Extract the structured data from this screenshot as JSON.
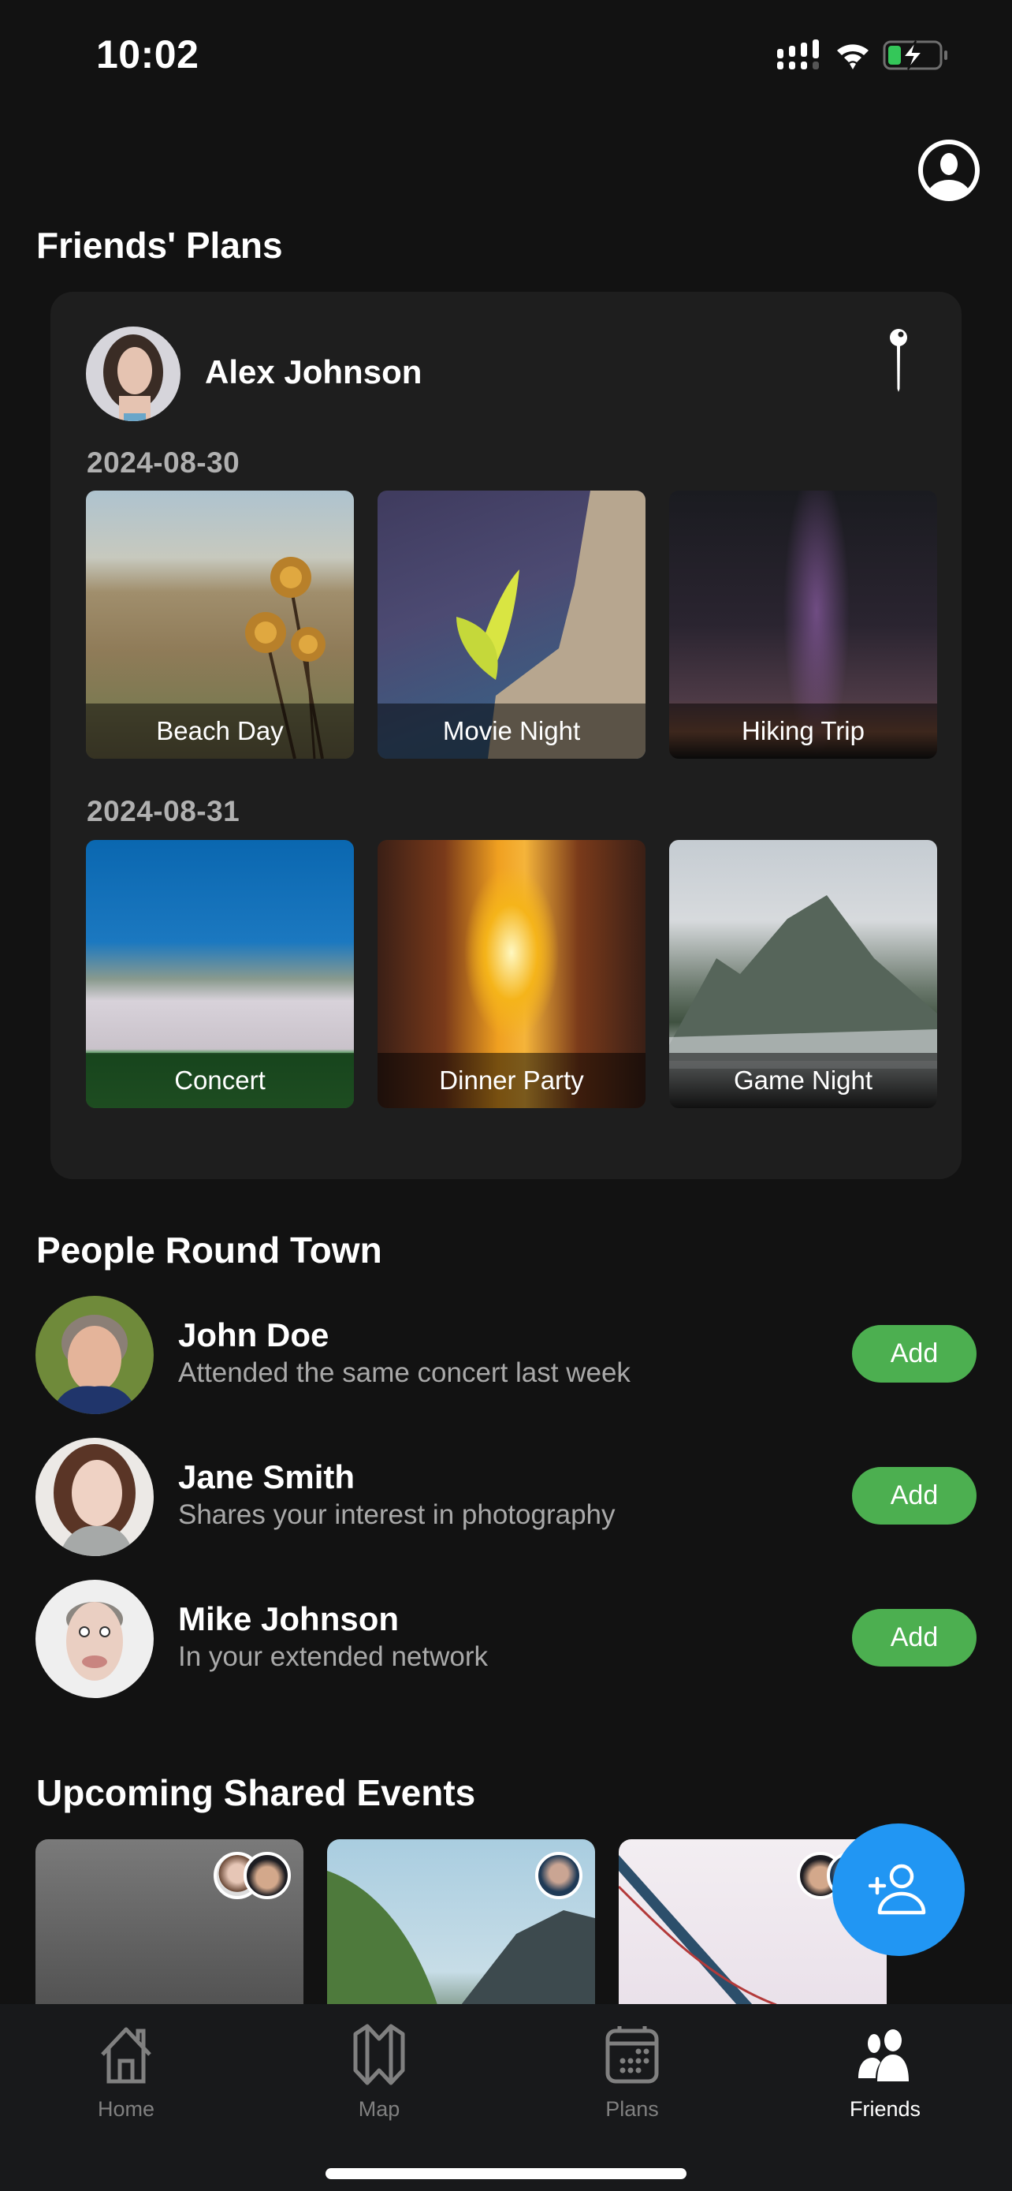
{
  "status_bar": {
    "time": "10:02",
    "battery_color": "#34c759"
  },
  "header": {
    "profile_icon": "user-circle-icon"
  },
  "friends_plans": {
    "title": "Friends' Plans",
    "friend": {
      "name": "Alex Johnson",
      "pin_icon": "pin-icon"
    },
    "days": [
      {
        "date": "2024-08-30",
        "plans": [
          {
            "label": "Beach Day",
            "image": "dry-flowers-valley"
          },
          {
            "label": "Movie Night",
            "image": "plant-on-rock"
          },
          {
            "label": "Hiking Trip",
            "image": "milky-way-night-sky"
          }
        ]
      },
      {
        "date": "2024-08-31",
        "plans": [
          {
            "label": "Concert",
            "image": "stadium-crowd-mountains"
          },
          {
            "label": "Dinner Party",
            "image": "sunset-city-street"
          },
          {
            "label": "Game Night",
            "image": "misty-mountain"
          }
        ]
      }
    ]
  },
  "people": {
    "title": "People Round Town",
    "add_label": "Add",
    "add_color": "#4caf50",
    "list": [
      {
        "name": "John Doe",
        "reason": "Attended the same concert last week"
      },
      {
        "name": "Jane Smith",
        "reason": "Shares your interest in photography"
      },
      {
        "name": "Mike Johnson",
        "reason": "In your extended network"
      }
    ]
  },
  "shared_events": {
    "title": "Upcoming Shared Events",
    "events": [
      {
        "image": "underwater-swimmer",
        "attendees": 2
      },
      {
        "image": "forest-mountain-valley",
        "attendees": 1
      },
      {
        "image": "suspension-bridge",
        "attendees": 2
      }
    ]
  },
  "fab": {
    "icon": "add-friend-icon",
    "color": "#2196f3"
  },
  "tabs": [
    {
      "label": "Home",
      "icon": "home-icon",
      "active": false
    },
    {
      "label": "Map",
      "icon": "map-icon",
      "active": false
    },
    {
      "label": "Plans",
      "icon": "calendar-icon",
      "active": false
    },
    {
      "label": "Friends",
      "icon": "friends-icon",
      "active": true
    }
  ]
}
